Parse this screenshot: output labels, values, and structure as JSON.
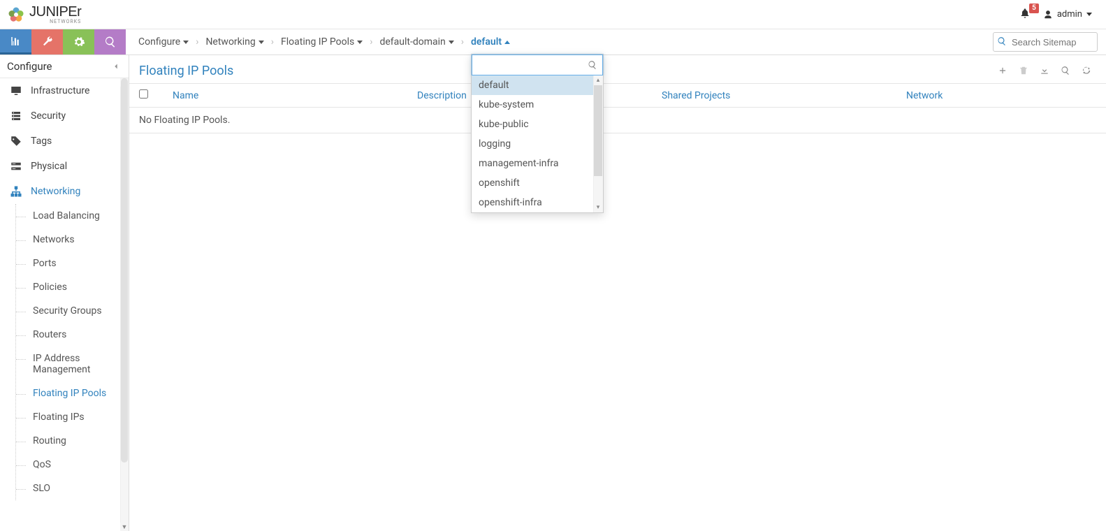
{
  "brand": {
    "name": "JUNIPEr",
    "sub": "NETWORKS"
  },
  "header": {
    "notif_count": "5",
    "user": "admin"
  },
  "breadcrumb": {
    "items": [
      "Configure",
      "Networking",
      "Floating IP Pools",
      "default-domain",
      "default"
    ]
  },
  "search_placeholder": "Search Sitemap",
  "sidebar": {
    "title": "Configure",
    "items": [
      {
        "label": "Infrastructure",
        "icon": "monitor"
      },
      {
        "label": "Security",
        "icon": "shield"
      },
      {
        "label": "Tags",
        "icon": "tag"
      },
      {
        "label": "Physical",
        "icon": "server"
      },
      {
        "label": "Networking",
        "icon": "sitemap",
        "active": true
      }
    ],
    "sub_items": [
      {
        "label": "Load Balancing"
      },
      {
        "label": "Networks"
      },
      {
        "label": "Ports"
      },
      {
        "label": "Policies"
      },
      {
        "label": "Security Groups"
      },
      {
        "label": "Routers"
      },
      {
        "label": "IP Address Management"
      },
      {
        "label": "Floating IP Pools",
        "active": true
      },
      {
        "label": "Floating IPs"
      },
      {
        "label": "Routing"
      },
      {
        "label": "QoS"
      },
      {
        "label": "SLO"
      }
    ]
  },
  "page": {
    "title": "Floating IP Pools",
    "columns": [
      "Name",
      "Description",
      "Shared Projects",
      "Network"
    ],
    "empty": "No Floating IP Pools."
  },
  "dropdown": {
    "search_value": "",
    "options": [
      "default",
      "kube-system",
      "kube-public",
      "logging",
      "management-infra",
      "openshift",
      "openshift-infra"
    ],
    "selected": "default"
  }
}
